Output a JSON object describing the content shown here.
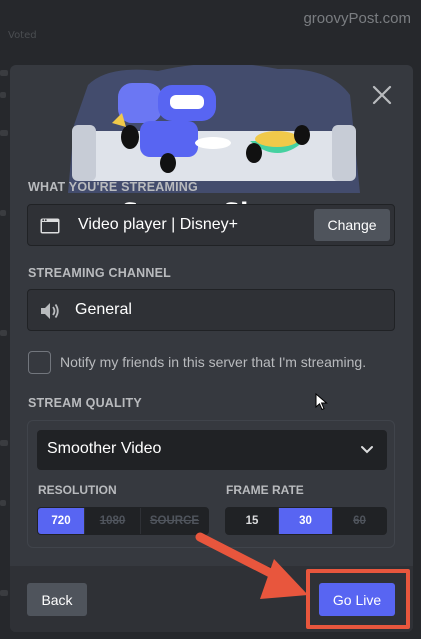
{
  "watermark": "groovyPost.com",
  "background": {
    "voted": "Voted"
  },
  "modal": {
    "title": "Screen Share",
    "streaming_label": "WHAT YOU'RE STREAMING",
    "streaming_source": "Video player | Disney+",
    "change_label": "Change",
    "channel_label": "STREAMING CHANNEL",
    "channel_name": "General",
    "notify_label": "Notify my friends in this server that I'm streaming.",
    "notify_checked": false,
    "quality_label": "STREAM QUALITY",
    "quality_selected": "Smoother Video",
    "resolution_label": "RESOLUTION",
    "resolution_options": [
      "720",
      "1080",
      "SOURCE"
    ],
    "resolution_selected": "720",
    "framerate_label": "FRAME RATE",
    "framerate_options": [
      "15",
      "30",
      "60"
    ],
    "framerate_selected": "30",
    "back_label": "Back",
    "golive_label": "Go Live"
  },
  "colors": {
    "accent": "#5865f2",
    "highlight": "#e8563d",
    "modal_bg": "#36393f",
    "footer_bg": "#2f3136"
  },
  "icons": [
    "close-icon",
    "window-icon",
    "speaker-icon",
    "chevron-down-icon",
    "arrow-annotation",
    "mouse-cursor-icon"
  ]
}
